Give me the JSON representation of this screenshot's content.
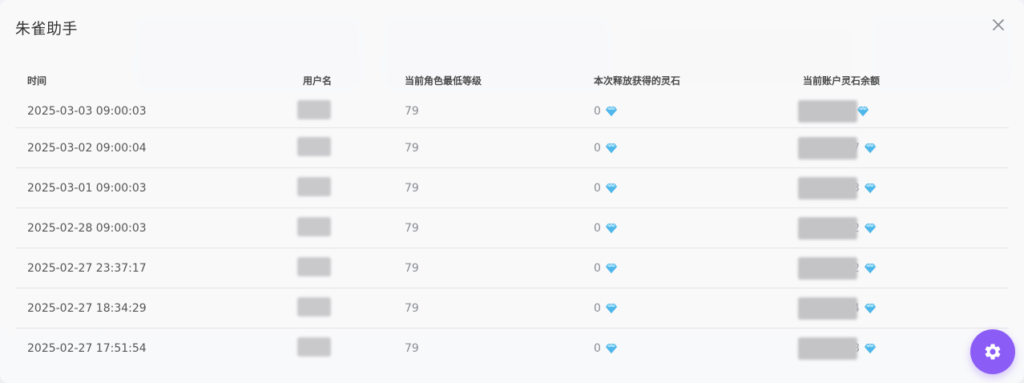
{
  "dialog": {
    "title": "朱雀助手"
  },
  "table": {
    "columns": [
      "时间",
      "用户名",
      "当前角色最低等级",
      "本次释放获得的灵石",
      "当前账户灵石余额"
    ],
    "rows": [
      {
        "time": "2025-03-03 09:00:03",
        "level": "79",
        "gain": "0",
        "balance_visible_suffix": ""
      },
      {
        "time": "2025-03-02 09:00:04",
        "level": "79",
        "gain": "0",
        "balance_visible_suffix": "7"
      },
      {
        "time": "2025-03-01 09:00:03",
        "level": "79",
        "gain": "0",
        "balance_visible_suffix": "3"
      },
      {
        "time": "2025-02-28 09:00:03",
        "level": "79",
        "gain": "0",
        "balance_visible_suffix": "2"
      },
      {
        "time": "2025-02-27 23:37:17",
        "level": "79",
        "gain": "0",
        "balance_visible_suffix": "2"
      },
      {
        "time": "2025-02-27 18:34:29",
        "level": "79",
        "gain": "0",
        "balance_visible_suffix": "4"
      },
      {
        "time": "2025-02-27 17:51:54",
        "level": "79",
        "gain": "0",
        "balance_visible_suffix": "8"
      }
    ]
  },
  "icons": {
    "close": "close-icon",
    "gem": "diamond-icon",
    "settings": "gear-icon"
  },
  "colors": {
    "accent": "#8b5cf6",
    "gem": "#5ac8fa"
  }
}
